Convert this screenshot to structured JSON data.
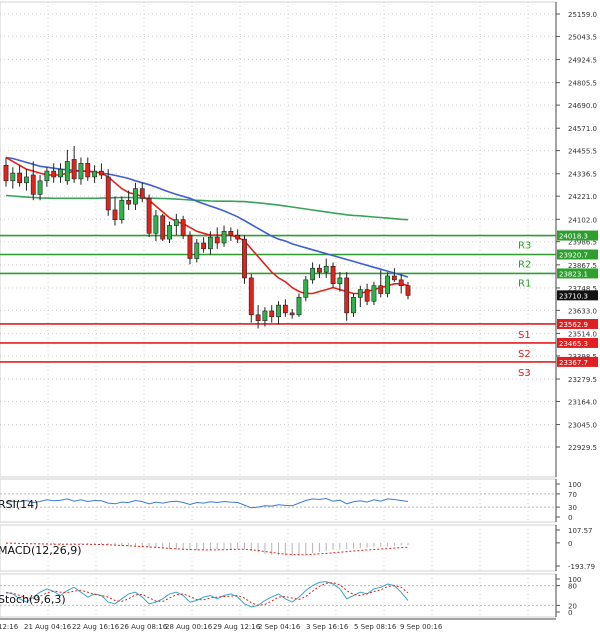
{
  "chart_data": {
    "type": "candlestick",
    "price_axis": {
      "ylim": [
        22929.5,
        25159.0
      ],
      "ticks": [
        25159.0,
        25043.5,
        24924.5,
        24805.5,
        24690.0,
        24571.0,
        24455.5,
        24336.5,
        24221.0,
        24102.0,
        23986.5,
        23867.5,
        23748.5,
        23633.0,
        23514.0,
        23398.5,
        23279.5,
        23164.0,
        23045.0,
        22929.5
      ]
    },
    "x_labels": [
      "12:16",
      "21 Aug 04:16",
      "22 Aug 16:16",
      "26 Aug 08:16",
      "28 Aug 00:16",
      "29 Aug 12:16",
      "2 Sep 04:16",
      "3 Sep 16:16",
      "5 Sep 08:16",
      "9 Sep 00:16"
    ],
    "levels": [
      {
        "name": "R3",
        "value": 24018.3,
        "label": "24018.3",
        "color": "#2e9e2e"
      },
      {
        "name": "R2",
        "value": 23920.7,
        "label": "23920.7",
        "color": "#2e9e2e"
      },
      {
        "name": "R1",
        "value": 23823.1,
        "label": "23823.1",
        "color": "#2e9e2e"
      },
      {
        "name": "S1",
        "value": 23562.9,
        "label": "23562.9",
        "color": "#e02020"
      },
      {
        "name": "S2",
        "value": 23465.3,
        "label": "23465.3",
        "color": "#e02020"
      },
      {
        "name": "S3",
        "value": 23367.7,
        "label": "23367.7",
        "color": "#e02020"
      }
    ],
    "level_labels": {
      "R3": "R3",
      "R2": "R2",
      "R1": "R1",
      "S1": "S1",
      "S2": "S2",
      "S3": "S3"
    },
    "current_price": {
      "value": 23710.3,
      "label": "23710.3"
    },
    "candles": [
      {
        "o": 24380,
        "h": 24420,
        "l": 24270,
        "c": 24300
      },
      {
        "o": 24300,
        "h": 24370,
        "l": 24260,
        "c": 24340
      },
      {
        "o": 24340,
        "h": 24380,
        "l": 24270,
        "c": 24290
      },
      {
        "o": 24290,
        "h": 24360,
        "l": 24250,
        "c": 24320
      },
      {
        "o": 24330,
        "h": 24400,
        "l": 24200,
        "c": 24230
      },
      {
        "o": 24230,
        "h": 24330,
        "l": 24200,
        "c": 24300
      },
      {
        "o": 24300,
        "h": 24370,
        "l": 24270,
        "c": 24350
      },
      {
        "o": 24350,
        "h": 24390,
        "l": 24290,
        "c": 24320
      },
      {
        "o": 24320,
        "h": 24390,
        "l": 24290,
        "c": 24360
      },
      {
        "o": 24300,
        "h": 24460,
        "l": 24280,
        "c": 24400
      },
      {
        "o": 24410,
        "h": 24480,
        "l": 24290,
        "c": 24310
      },
      {
        "o": 24310,
        "h": 24420,
        "l": 24280,
        "c": 24390
      },
      {
        "o": 24390,
        "h": 24420,
        "l": 24300,
        "c": 24320
      },
      {
        "o": 24320,
        "h": 24380,
        "l": 24290,
        "c": 24350
      },
      {
        "o": 24350,
        "h": 24390,
        "l": 24310,
        "c": 24330
      },
      {
        "o": 24320,
        "h": 24360,
        "l": 24120,
        "c": 24150
      },
      {
        "o": 24150,
        "h": 24220,
        "l": 24070,
        "c": 24100
      },
      {
        "o": 24100,
        "h": 24220,
        "l": 24080,
        "c": 24200
      },
      {
        "o": 24200,
        "h": 24250,
        "l": 24150,
        "c": 24180
      },
      {
        "o": 24180,
        "h": 24290,
        "l": 24150,
        "c": 24260
      },
      {
        "o": 24260,
        "h": 24290,
        "l": 24190,
        "c": 24210
      },
      {
        "o": 24210,
        "h": 24230,
        "l": 24010,
        "c": 24030
      },
      {
        "o": 24030,
        "h": 24150,
        "l": 23990,
        "c": 24120
      },
      {
        "o": 24120,
        "h": 24130,
        "l": 23990,
        "c": 24000
      },
      {
        "o": 24000,
        "h": 24090,
        "l": 23980,
        "c": 24070
      },
      {
        "o": 24070,
        "h": 24130,
        "l": 24020,
        "c": 24100
      },
      {
        "o": 24100,
        "h": 24120,
        "l": 24000,
        "c": 24020
      },
      {
        "o": 24020,
        "h": 24040,
        "l": 23870,
        "c": 23900
      },
      {
        "o": 23900,
        "h": 24000,
        "l": 23880,
        "c": 23980
      },
      {
        "o": 23980,
        "h": 24010,
        "l": 23930,
        "c": 23950
      },
      {
        "o": 23950,
        "h": 24040,
        "l": 23920,
        "c": 24010
      },
      {
        "o": 24010,
        "h": 24060,
        "l": 23950,
        "c": 23980
      },
      {
        "o": 23980,
        "h": 24070,
        "l": 23960,
        "c": 24040
      },
      {
        "o": 24040,
        "h": 24060,
        "l": 23990,
        "c": 24020
      },
      {
        "o": 24020,
        "h": 24050,
        "l": 23980,
        "c": 24000
      },
      {
        "o": 24000,
        "h": 24020,
        "l": 23770,
        "c": 23800
      },
      {
        "o": 23800,
        "h": 23820,
        "l": 23570,
        "c": 23610
      },
      {
        "o": 23610,
        "h": 23660,
        "l": 23540,
        "c": 23580
      },
      {
        "o": 23580,
        "h": 23650,
        "l": 23550,
        "c": 23630
      },
      {
        "o": 23630,
        "h": 23660,
        "l": 23570,
        "c": 23600
      },
      {
        "o": 23600,
        "h": 23680,
        "l": 23560,
        "c": 23660
      },
      {
        "o": 23660,
        "h": 23690,
        "l": 23600,
        "c": 23620
      },
      {
        "o": 23620,
        "h": 23640,
        "l": 23590,
        "c": 23610
      },
      {
        "o": 23610,
        "h": 23720,
        "l": 23600,
        "c": 23700
      },
      {
        "o": 23700,
        "h": 23810,
        "l": 23680,
        "c": 23790
      },
      {
        "o": 23790,
        "h": 23880,
        "l": 23770,
        "c": 23850
      },
      {
        "o": 23850,
        "h": 23870,
        "l": 23800,
        "c": 23830
      },
      {
        "o": 23830,
        "h": 23900,
        "l": 23800,
        "c": 23860
      },
      {
        "o": 23860,
        "h": 23880,
        "l": 23750,
        "c": 23770
      },
      {
        "o": 23770,
        "h": 23830,
        "l": 23730,
        "c": 23800
      },
      {
        "o": 23800,
        "h": 23830,
        "l": 23580,
        "c": 23620
      },
      {
        "o": 23620,
        "h": 23720,
        "l": 23600,
        "c": 23700
      },
      {
        "o": 23700,
        "h": 23760,
        "l": 23650,
        "c": 23740
      },
      {
        "o": 23740,
        "h": 23770,
        "l": 23660,
        "c": 23680
      },
      {
        "o": 23680,
        "h": 23780,
        "l": 23660,
        "c": 23760
      },
      {
        "o": 23760,
        "h": 23840,
        "l": 23700,
        "c": 23720
      },
      {
        "o": 23720,
        "h": 23830,
        "l": 23700,
        "c": 23810
      },
      {
        "o": 23810,
        "h": 23850,
        "l": 23780,
        "c": 23790
      },
      {
        "o": 23790,
        "h": 23820,
        "l": 23720,
        "c": 23760
      },
      {
        "o": 23760,
        "h": 23780,
        "l": 23690,
        "c": 23710
      }
    ],
    "ma_red": [
      24420,
      24400,
      24380,
      24360,
      24350,
      24340,
      24330,
      24330,
      24330,
      24340,
      24350,
      24350,
      24350,
      24345,
      24340,
      24320,
      24290,
      24260,
      24240,
      24230,
      24220,
      24200,
      24170,
      24140,
      24110,
      24090,
      24080,
      24060,
      24040,
      24030,
      24020,
      24020,
      24020,
      24020,
      24010,
      23990,
      23950,
      23910,
      23870,
      23830,
      23800,
      23780,
      23750,
      23730,
      23720,
      23720,
      23730,
      23740,
      23750,
      23740,
      23730,
      23720,
      23720,
      23730,
      23740,
      23750,
      23760,
      23770,
      23770,
      23760
    ],
    "ma_blue": [
      24420,
      24415,
      24405,
      24395,
      24385,
      24375,
      24370,
      24365,
      24360,
      24357,
      24354,
      24351,
      24348,
      24345,
      24340,
      24335,
      24328,
      24320,
      24312,
      24300,
      24290,
      24280,
      24268,
      24255,
      24242,
      24230,
      24220,
      24210,
      24195,
      24182,
      24170,
      24158,
      24145,
      24130,
      24115,
      24095,
      24075,
      24055,
      24035,
      24015,
      24000,
      23990,
      23975,
      23965,
      23955,
      23945,
      23935,
      23925,
      23915,
      23905,
      23895,
      23885,
      23875,
      23865,
      23855,
      23845,
      23835,
      23825,
      23815,
      23805
    ],
    "ma_green": [
      24225,
      24222,
      24219,
      24216,
      24214,
      24212,
      24211,
      24210,
      24210,
      24210,
      24210,
      24210,
      24210,
      24210,
      24211,
      24212,
      24213,
      24214,
      24214,
      24213,
      24212,
      24211,
      24210,
      24209,
      24208,
      24206,
      24204,
      24202,
      24200,
      24198,
      24196,
      24195,
      24195,
      24195,
      24194,
      24193,
      24190,
      24187,
      24183,
      24179,
      24175,
      24170,
      24165,
      24160,
      24155,
      24150,
      24145,
      24140,
      24135,
      24130,
      24125,
      24122,
      24120,
      24117,
      24114,
      24111,
      24108,
      24105,
      24102,
      24100
    ],
    "rsi": {
      "label": "RSI(14)",
      "ticks": [
        100,
        70,
        30,
        0
      ],
      "ylim": [
        0,
        100
      ],
      "values": [
        45,
        48,
        46,
        50,
        44,
        47,
        52,
        49,
        51,
        55,
        48,
        52,
        47,
        50,
        49,
        42,
        40,
        45,
        44,
        50,
        47,
        40,
        45,
        42,
        46,
        48,
        44,
        38,
        44,
        42,
        46,
        44,
        47,
        45,
        44,
        36,
        28,
        30,
        34,
        33,
        37,
        35,
        34,
        42,
        50,
        55,
        53,
        56,
        48,
        51,
        40,
        46,
        49,
        45,
        52,
        48,
        55,
        53,
        50,
        47
      ]
    },
    "macd": {
      "label": "MACD(12,26,9)",
      "ticks": [
        107.57,
        0.0,
        -193.79
      ],
      "ylim": [
        -193.79,
        107.57
      ],
      "hist": [
        0,
        -2,
        -4,
        -6,
        -8,
        -10,
        -12,
        -12,
        -11,
        -10,
        -10,
        -11,
        -12,
        -13,
        -14,
        -18,
        -22,
        -26,
        -30,
        -33,
        -36,
        -40,
        -45,
        -50,
        -54,
        -58,
        -60,
        -62,
        -62,
        -60,
        -58,
        -56,
        -54,
        -52,
        -50,
        -55,
        -68,
        -80,
        -92,
        -100,
        -105,
        -108,
        -108,
        -104,
        -96,
        -86,
        -76,
        -68,
        -60,
        -54,
        -52,
        -48,
        -44,
        -40,
        -36,
        -32,
        -28,
        -24,
        -20,
        -18
      ],
      "signal": [
        -2,
        -3,
        -5,
        -6,
        -8,
        -9,
        -10,
        -11,
        -11,
        -11,
        -11,
        -12,
        -12,
        -13,
        -14,
        -16,
        -19,
        -22,
        -25,
        -28,
        -31,
        -34,
        -38,
        -42,
        -46,
        -50,
        -53,
        -56,
        -58,
        -59,
        -59,
        -58,
        -57,
        -56,
        -54,
        -54,
        -58,
        -64,
        -72,
        -80,
        -88,
        -94,
        -98,
        -100,
        -99,
        -96,
        -92,
        -88,
        -83,
        -78,
        -73,
        -68,
        -64,
        -60,
        -56,
        -52,
        -48,
        -44,
        -40,
        -36
      ]
    },
    "stoch": {
      "label": "Stoch(9,6,3)",
      "ticks": [
        100,
        80,
        20,
        0
      ],
      "ylim": [
        0,
        100
      ],
      "k": [
        60,
        55,
        40,
        30,
        45,
        60,
        70,
        62,
        50,
        65,
        75,
        60,
        45,
        55,
        50,
        30,
        25,
        40,
        55,
        60,
        45,
        25,
        30,
        40,
        55,
        60,
        50,
        30,
        35,
        45,
        50,
        40,
        50,
        55,
        45,
        25,
        15,
        20,
        35,
        45,
        55,
        40,
        30,
        45,
        65,
        80,
        90,
        92,
        85,
        70,
        40,
        50,
        60,
        55,
        70,
        75,
        85,
        80,
        60,
        35
      ],
      "d": [
        58,
        57,
        50,
        42,
        40,
        48,
        58,
        64,
        60,
        59,
        63,
        66,
        60,
        53,
        50,
        45,
        35,
        32,
        40,
        52,
        53,
        43,
        33,
        32,
        42,
        52,
        55,
        47,
        38,
        37,
        43,
        45,
        47,
        48,
        50,
        42,
        28,
        20,
        23,
        33,
        45,
        47,
        42,
        38,
        47,
        63,
        78,
        87,
        89,
        82,
        65,
        53,
        50,
        55,
        62,
        67,
        77,
        80,
        75,
        58
      ]
    }
  }
}
